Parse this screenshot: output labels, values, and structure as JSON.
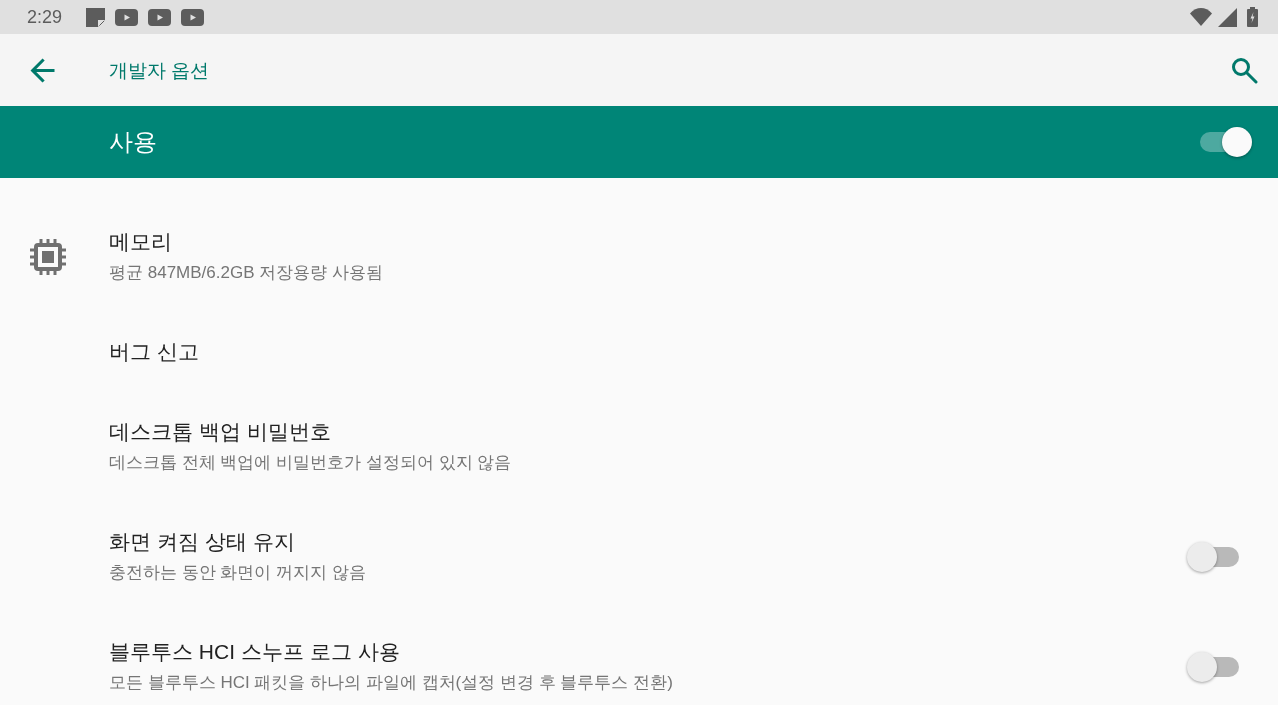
{
  "status_bar": {
    "time": "2:29"
  },
  "app_bar": {
    "title": "개발자 옵션"
  },
  "master_switch": {
    "label": "사용",
    "on": true
  },
  "settings": [
    {
      "kind": "icon",
      "title": "메모리",
      "summary": "평균 847MB/6.2GB 저장용량 사용됨"
    },
    {
      "kind": "plain",
      "title": "버그 신고"
    },
    {
      "kind": "plain",
      "title": "데스크톱 백업 비밀번호",
      "summary": "데스크톱 전체 백업에 비밀번호가 설정되어 있지 않음"
    },
    {
      "kind": "switch",
      "title": "화면 켜짐 상태 유지",
      "summary": "충전하는 동안 화면이 꺼지지 않음",
      "on": false
    },
    {
      "kind": "switch",
      "title": "블루투스 HCI 스누프 로그 사용",
      "summary": "모든 블루투스 HCI 패킷을 하나의 파일에 캡처(설정 변경 후 블루투스 전환)",
      "on": false
    }
  ]
}
